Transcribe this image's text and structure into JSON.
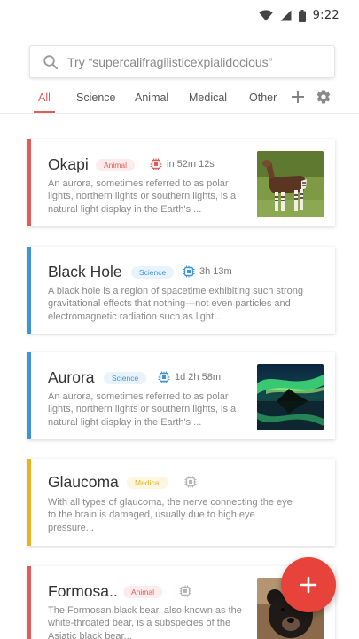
{
  "status_bar": {
    "time": "9:22"
  },
  "search": {
    "placeholder": "Try “supercalifragilisticexpialidocious”"
  },
  "tabs": [
    {
      "label": "All",
      "active": true
    },
    {
      "label": "Science",
      "active": false
    },
    {
      "label": "Animal",
      "active": false
    },
    {
      "label": "Medical",
      "active": false
    },
    {
      "label": "Other",
      "active": false
    }
  ],
  "colors": {
    "accent": "#e05c5a",
    "animal": "#e05c5a",
    "science": "#3f94d6",
    "medical": "#e8b321",
    "fab": "#e8433a"
  },
  "cards": [
    {
      "title": "Okapi",
      "category": "Animal",
      "timer": "in 52m 12s",
      "description": "An aurora, sometimes referred to as polar lights, northern lights or southern lights, is a natural light display in the Earth's ...",
      "image": "okapi-photo"
    },
    {
      "title": "Black Hole",
      "category": "Science",
      "timer": "3h 13m",
      "description": "A black hole is a region of spacetime exhibiting such strong gravitational effects that nothing—not even particles and electromagnetic radiation such as light...",
      "image": null
    },
    {
      "title": "Aurora",
      "category": "Science",
      "timer": "1d 2h 58m",
      "description": "An aurora, sometimes referred to as polar lights, northern lights or southern lights, is a natural light display in the Earth's ...",
      "image": "aurora-photo"
    },
    {
      "title": "Glaucoma",
      "category": "Medical",
      "timer": "",
      "description": "With all types of glaucoma, the nerve connecting the eye to the brain is damaged, usually due to high eye pressure...",
      "image": null
    },
    {
      "title": "Formosa..",
      "category": "Animal",
      "timer": "",
      "description": "The Formosan black bear, also known as the white-throated bear, is a subspecies of the Asiatic black bear...",
      "image": "bear-photo"
    }
  ],
  "fab": {
    "icon": "plus-icon"
  }
}
